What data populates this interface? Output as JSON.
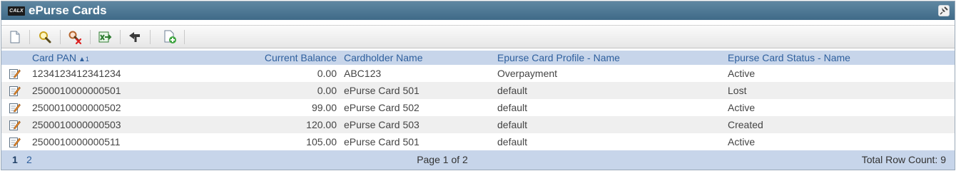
{
  "header": {
    "logo_text": "CALX",
    "title": "ePurse Cards"
  },
  "toolbar": {
    "buttons": [
      {
        "icon": "new-document-icon"
      },
      {
        "icon": "search-icon"
      },
      {
        "icon": "clear-search-icon"
      },
      {
        "icon": "export-excel-icon"
      },
      {
        "icon": "back-arrow-icon"
      },
      {
        "icon": "add-page-icon"
      }
    ]
  },
  "grid": {
    "columns": [
      "Card PAN",
      "Current Balance",
      "Cardholder Name",
      "Epurse Card Profile - Name",
      "Epurse Card Status - Name"
    ],
    "sort_rank": "1",
    "rows": [
      {
        "pan": "1234123412341234",
        "balance": "0.00",
        "name": "ABC123",
        "profile": "Overpayment",
        "status": "Active"
      },
      {
        "pan": "2500010000000501",
        "balance": "0.00",
        "name": "ePurse Card 501",
        "profile": "default",
        "status": "Lost"
      },
      {
        "pan": "2500010000000502",
        "balance": "99.00",
        "name": "ePurse Card 502",
        "profile": "default",
        "status": "Active"
      },
      {
        "pan": "2500010000000503",
        "balance": "120.00",
        "name": "ePurse Card 503",
        "profile": "default",
        "status": "Created"
      },
      {
        "pan": "2500010000000511",
        "balance": "105.00",
        "name": "ePurse Card 501",
        "profile": "default",
        "status": "Active"
      }
    ]
  },
  "footer": {
    "pages": [
      "1",
      "2"
    ],
    "current_page": "1",
    "page_info": "Page 1 of 2",
    "row_count": "Total Row Count: 9"
  },
  "colors": {
    "titlebar": "#4a7494",
    "header_bg": "#c7d5ea",
    "header_text": "#2e5f9d"
  }
}
